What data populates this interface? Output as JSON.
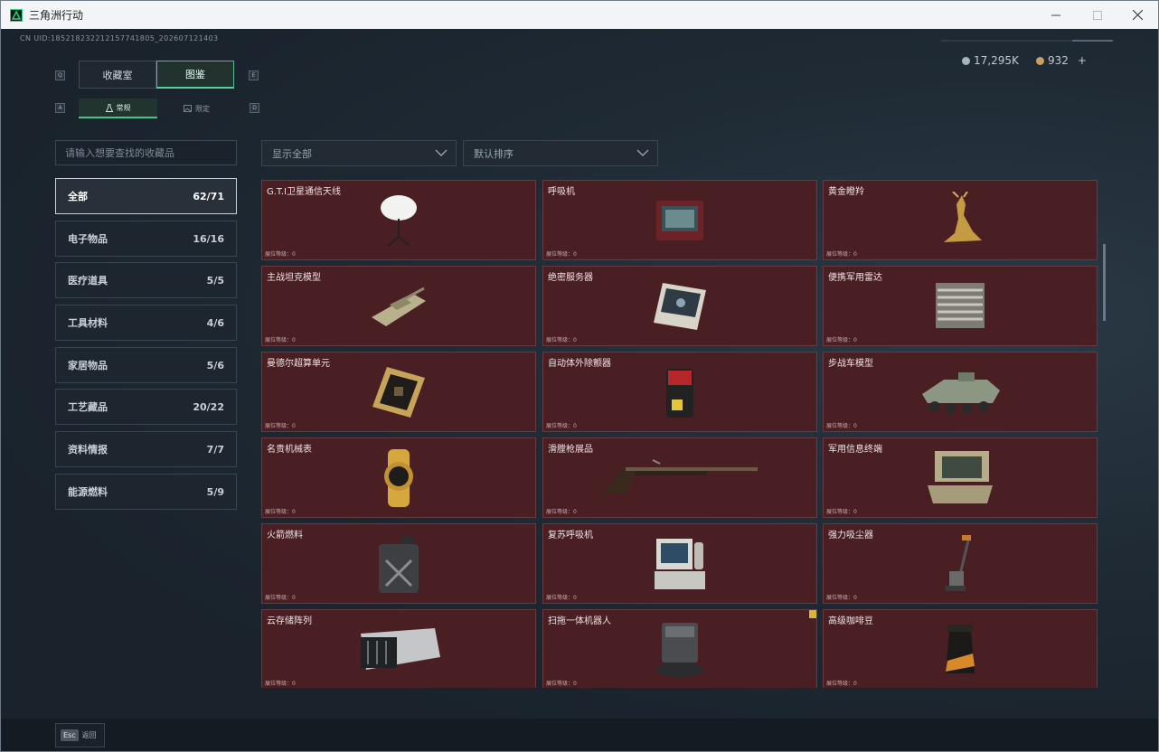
{
  "window": {
    "title": "三角洲行动"
  },
  "header": {
    "uid": "CN UID:185218232212157741805_202607121403",
    "currency": [
      {
        "value": "17,295K",
        "icon": "silver-coin-icon",
        "color": "#a7b3bd"
      },
      {
        "value": "932",
        "icon": "gold-coin-icon",
        "color": "#c9a063"
      }
    ],
    "plus_label": "+"
  },
  "tabs": [
    {
      "label": "收藏室",
      "active": false
    },
    {
      "label": "图鉴",
      "active": true
    }
  ],
  "tab_keys": {
    "left": "Q",
    "right": "E"
  },
  "subtabs": [
    {
      "label": "常规",
      "icon": "flask-icon",
      "active": true
    },
    {
      "label": "限定",
      "icon": "image-icon",
      "active": false
    }
  ],
  "subtab_keys": {
    "left": "A",
    "right": "D"
  },
  "search": {
    "placeholder": "请输入想要查找的收藏品",
    "value": ""
  },
  "filters": {
    "display": "显示全部",
    "sort": "默认排序"
  },
  "categories": [
    {
      "label": "全部",
      "count": "62/71",
      "active": true
    },
    {
      "label": "电子物品",
      "count": "16/16"
    },
    {
      "label": "医疗道具",
      "count": "5/5"
    },
    {
      "label": "工具材料",
      "count": "4/6"
    },
    {
      "label": "家居物品",
      "count": "5/6"
    },
    {
      "label": "工艺藏品",
      "count": "20/22"
    },
    {
      "label": "资料情报",
      "count": "7/7"
    },
    {
      "label": "能源燃料",
      "count": "5/9"
    }
  ],
  "items": [
    {
      "name": "G.T.I卫星通信天线",
      "level": "展位等级：0",
      "icon": "satellite-dish-icon"
    },
    {
      "name": "呼吸机",
      "level": "展位等级：0",
      "icon": "ventilator-icon"
    },
    {
      "name": "黄金瞪羚",
      "level": "展位等级：0",
      "icon": "golden-gazelle-icon"
    },
    {
      "name": "主战坦克模型",
      "level": "展位等级：0",
      "icon": "tank-model-icon"
    },
    {
      "name": "绝密服务器",
      "level": "展位等级：0",
      "icon": "server-icon"
    },
    {
      "name": "便携军用雷达",
      "level": "展位等级：0",
      "icon": "radar-icon"
    },
    {
      "name": "曼德尔超算单元",
      "level": "展位等级：0",
      "icon": "supercomputer-unit-icon"
    },
    {
      "name": "自动体外除颤器",
      "level": "展位等级：0",
      "icon": "defibrillator-icon"
    },
    {
      "name": "步战车模型",
      "level": "展位等级：0",
      "icon": "ifv-model-icon"
    },
    {
      "name": "名贵机械表",
      "level": "展位等级：0",
      "icon": "watch-icon"
    },
    {
      "name": "滑膛枪展品",
      "level": "展位等级：0",
      "icon": "musket-icon"
    },
    {
      "name": "军用信息终端",
      "level": "展位等级：0",
      "icon": "military-terminal-icon"
    },
    {
      "name": "火箭燃料",
      "level": "展位等级：0",
      "icon": "fuel-can-icon"
    },
    {
      "name": "复苏呼吸机",
      "level": "展位等级：0",
      "icon": "resuscitator-icon"
    },
    {
      "name": "强力吸尘器",
      "level": "展位等级：0",
      "icon": "vacuum-cleaner-icon"
    },
    {
      "name": "云存储阵列",
      "level": "展位等级：0",
      "icon": "storage-array-icon"
    },
    {
      "name": "扫拖一体机器人",
      "level": "展位等级：0",
      "icon": "robot-vacuum-icon",
      "badge": true
    },
    {
      "name": "高级咖啡豆",
      "level": "展位等级：0",
      "icon": "coffee-bag-icon"
    }
  ],
  "footer": {
    "esc_key": "Esc",
    "esc_label": "返回"
  }
}
